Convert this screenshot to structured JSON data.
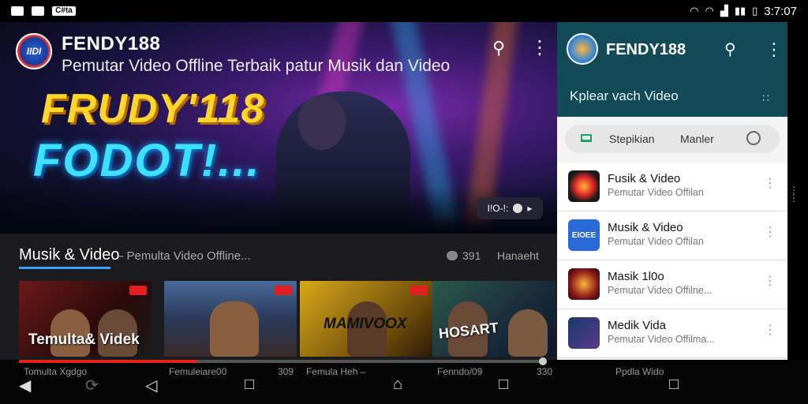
{
  "status_bar": {
    "left_icons": [
      "notification-icon",
      "gallery-icon",
      "app-badge-icon"
    ],
    "app_badge_text": "C#ta",
    "right_icons": [
      "wifi-icon",
      "wifi-alt-icon",
      "signal-icon",
      "network-icon",
      "battery-icon"
    ],
    "time": "3:7:07"
  },
  "main": {
    "app_title": "FENDY188",
    "app_logo_text": "IIDI",
    "subtitle": "Pemutar Video Offline Terbaik patur Musik dan Video",
    "hero_line1": "FRUDY'118",
    "hero_line2": "FODOT!...",
    "hero_control_label": "I!O-!:",
    "section": {
      "title": "Musik & Video",
      "subtitle": "– Pemulta Video Offline...",
      "count": "391",
      "more": "Hanaeht"
    },
    "thumbnails": [
      {
        "caption": "Temulta& Videk",
        "label": "Tomulta Xgdgo"
      },
      {
        "caption": "",
        "label": "Femuleiare00"
      },
      {
        "caption": "MAMIVOOX",
        "label": "309"
      },
      {
        "caption": "HOSART",
        "label": "Femula Heh –"
      }
    ],
    "extra_labels": [
      "Fenndo/09",
      "330"
    ],
    "progress_percent": 34
  },
  "panel": {
    "title": "FENDY188",
    "heading": "Kplear vach Video",
    "segment_a": "Stepikian",
    "segment_b": "Manler",
    "items": [
      {
        "name": "Fusik & Video",
        "desc": "Pemutar Video Offilan"
      },
      {
        "name": "Musik & Video",
        "desc": "Pemutar Video Offilan",
        "thumb_text": "EIOEE"
      },
      {
        "name": "Masik  1l0o",
        "desc": "Pemutar Video Offilne..."
      },
      {
        "name": "Medik  Vida",
        "desc": "Pemutar Video Offilma..."
      }
    ],
    "partial_item": "Ppdla Wido"
  },
  "colors": {
    "accent_blue": "#3aa0ff",
    "progress_red": "#e62117",
    "panel_header": "#124a57"
  }
}
